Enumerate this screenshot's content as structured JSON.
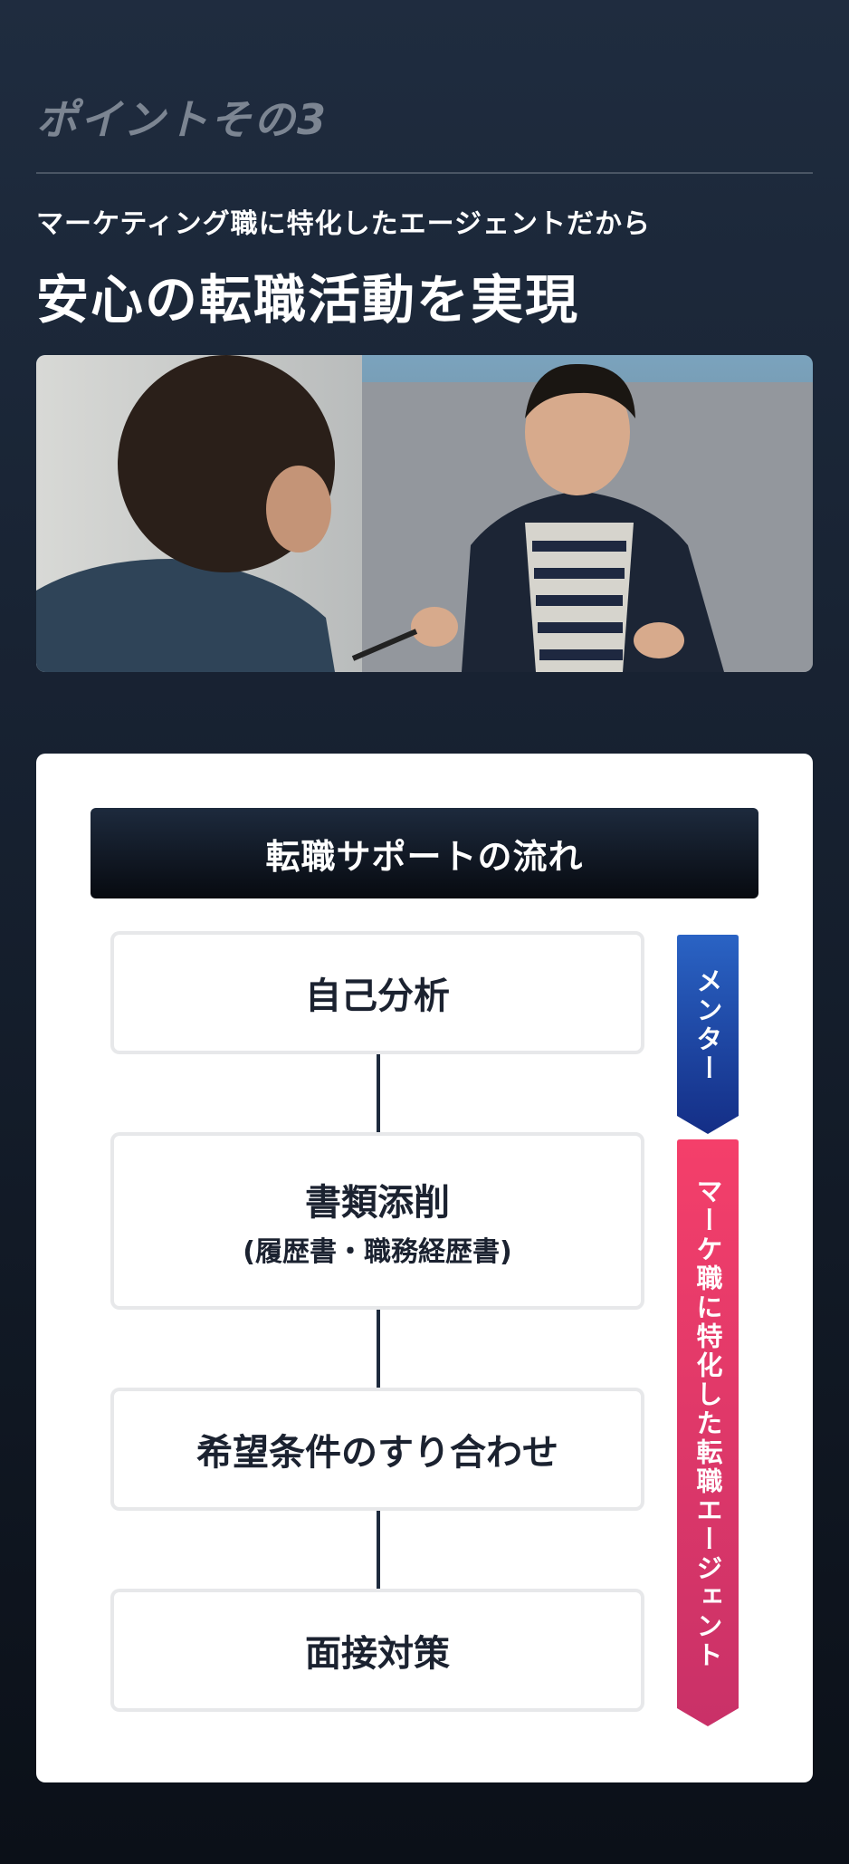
{
  "header": {
    "point_label": "ポイントその3",
    "subtitle": "マーケティング職に特化したエージェントだから",
    "title": "安心の転職活動を実現"
  },
  "photo": {
    "alt": "photo"
  },
  "flow": {
    "title": "転職サポートの流れ",
    "steps": [
      {
        "label": "自己分析",
        "sub": ""
      },
      {
        "label": "書類添削",
        "sub": "(履歴書・職務経歴書)"
      },
      {
        "label": "希望条件のすり合わせ",
        "sub": ""
      },
      {
        "label": "面接対策",
        "sub": ""
      }
    ],
    "ribbons": [
      {
        "label": "メンター",
        "color": "#1f49a8"
      },
      {
        "label": "マーケ職に特化した転職エージェント",
        "color": "#e43c6a"
      }
    ]
  },
  "colors": {
    "accent_blue": "#1f49a8",
    "accent_pink": "#e43c6a",
    "dark_navy": "#1d2a3d"
  }
}
